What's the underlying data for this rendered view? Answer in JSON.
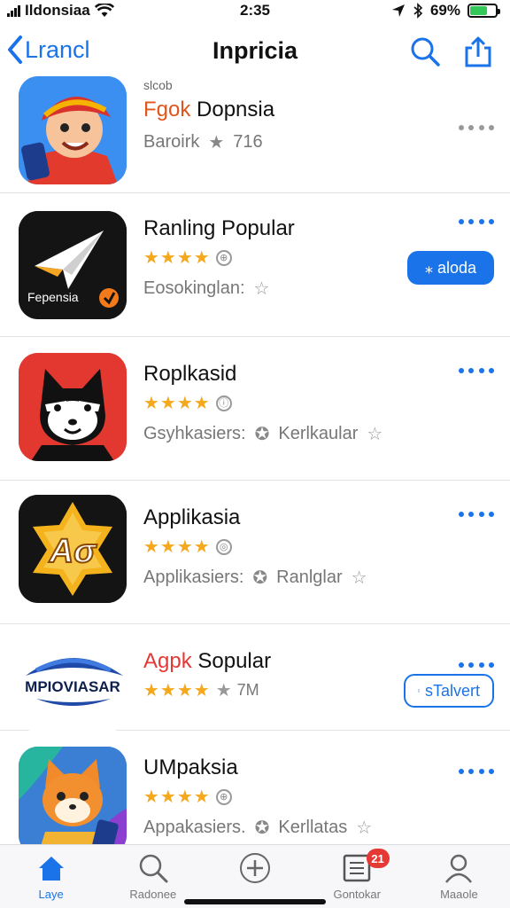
{
  "status_bar": {
    "carrier": "Ildonsiaa",
    "time": "2:35",
    "battery": "69%"
  },
  "nav": {
    "back_label": "Lrancl",
    "title": "Inpricia",
    "search_icon": "search-icon",
    "share_icon": "share-icon"
  },
  "apps": [
    {
      "subtitle": "slcob",
      "name_accent": "Fgok",
      "name_rest": " Dopnsia",
      "meta": "Baroirk",
      "rating_text": "716",
      "accent_color": "#e0561a"
    },
    {
      "name": "Ranling Popular",
      "stars": "★★★★",
      "meta": "Eosokinglan:",
      "action": "⁎ aloda"
    },
    {
      "name": "Roplkasid",
      "stars": "★★★★",
      "meta": "Gsyhkasiers:",
      "meta2": "Kerlkaular"
    },
    {
      "name": "Applikasia",
      "stars": "★★★★",
      "meta": "Applikasiers:",
      "meta2": "Ranlglar"
    },
    {
      "name_accent": "Agpk",
      "name_rest": " Sopular",
      "stars": "★★★★",
      "rating_text": "7M",
      "logo_text": "MPIOVIASAR",
      "action": "sTalvert",
      "accent_color": "#e53935"
    },
    {
      "name": "UMpaksia",
      "stars": "★★★★",
      "meta": "Appakasiers.",
      "meta2": "Kerllatas"
    }
  ],
  "app_icons": {
    "paper_plane_label": "Fepensia"
  },
  "tabs": [
    {
      "label": "Laye",
      "icon": "home-icon"
    },
    {
      "label": "Radonee",
      "icon": "search-icon"
    },
    {
      "label": "",
      "icon": "plus-circle-icon"
    },
    {
      "label": "Gontokar",
      "icon": "list-icon",
      "badge": "21"
    },
    {
      "label": "Maaole",
      "icon": "person-icon"
    }
  ],
  "colors": {
    "accent": "#1a73e8",
    "star": "#f4a81d",
    "badge": "#e53935"
  }
}
